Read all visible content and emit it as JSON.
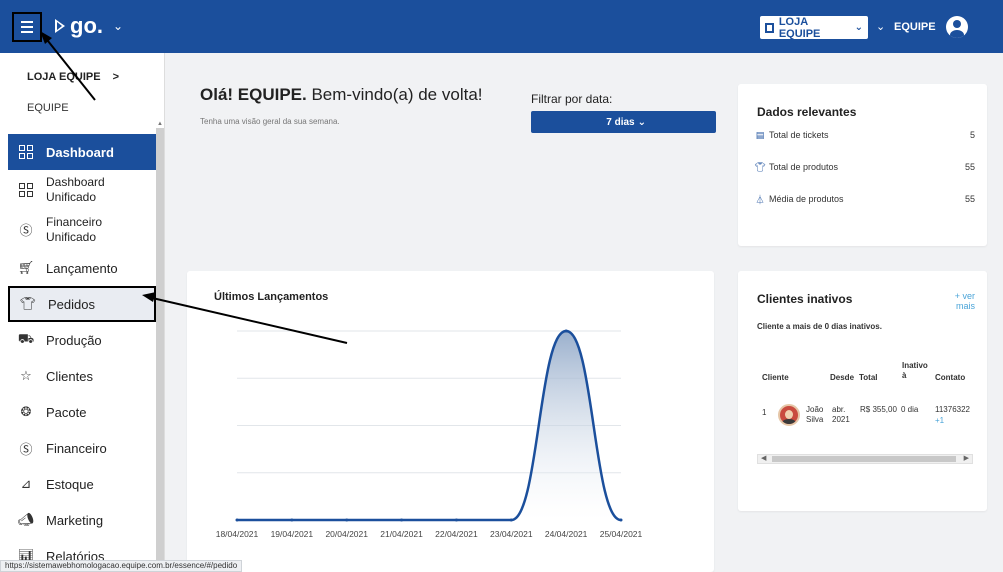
{
  "header": {
    "brand": "go.",
    "store_label": "LOJA EQUIPE",
    "user_label": "EQUIPE"
  },
  "sidebar": {
    "store_title": "LOJA EQUIPE",
    "store_chevron": ">",
    "store_subtitle": "EQUIPE",
    "items": [
      {
        "label": "Dashboard",
        "icon": "dashboard-icon"
      },
      {
        "label": "Dashboard\nUnificado",
        "icon": "dashboard-icon"
      },
      {
        "label": "Financeiro\nUnificado",
        "icon": "dollar-icon"
      },
      {
        "label": "Lançamento",
        "icon": "cart-icon"
      },
      {
        "label": "Pedidos",
        "icon": "shirt-icon"
      },
      {
        "label": "Produção",
        "icon": "truck-icon"
      },
      {
        "label": "Clientes",
        "icon": "star-icon"
      },
      {
        "label": "Pacote",
        "icon": "package-icon"
      },
      {
        "label": "Financeiro",
        "icon": "dollar-icon"
      },
      {
        "label": "Estoque",
        "icon": "stock-icon"
      },
      {
        "label": "Marketing",
        "icon": "megaphone-icon"
      },
      {
        "label": "Relatórios",
        "icon": "report-icon"
      }
    ]
  },
  "welcome": {
    "greeting_bold": "Olá! EQUIPE.",
    "greeting_rest": " Bem-vindo(a) de volta!",
    "subtitle": "Tenha uma visão geral da sua semana."
  },
  "filter": {
    "label": "Filtrar por data:",
    "value": "7 dias"
  },
  "relevant": {
    "title": "Dados relevantes",
    "rows": [
      {
        "label": "Total de tickets",
        "value": "5"
      },
      {
        "label": "Total de produtos",
        "value": "55"
      },
      {
        "label": "Média de produtos",
        "value": "55"
      }
    ]
  },
  "inactive": {
    "title": "Clientes inativos",
    "see_more": "+ ver mais",
    "subtitle": "Cliente a mais de 0 dias inativos.",
    "columns": [
      "Cliente",
      "Desde",
      "Total",
      "Inativo à",
      "Contato"
    ],
    "rows": [
      {
        "index": "1",
        "name": "João Silva",
        "since": "abr. 2021",
        "total": "R$ 355,00",
        "inactive": "0 dia",
        "contact": "11376322",
        "contact_more": "+1"
      }
    ]
  },
  "status_url": "https://sistemawebhomologacao.equipe.com.br/essence/#/pedido",
  "colors": {
    "primary": "#1b4f9c",
    "link": "#4aa4d8"
  },
  "chart_data": {
    "type": "area",
    "title": "Últimos Lançamentos",
    "x": [
      "18/04/2021",
      "19/04/2021",
      "20/04/2021",
      "21/04/2021",
      "22/04/2021",
      "23/04/2021",
      "24/04/2021",
      "25/04/2021"
    ],
    "series": [
      {
        "values": [
          0,
          0,
          0,
          0,
          0,
          0,
          4,
          0
        ]
      }
    ],
    "ylim": [
      0,
      4
    ],
    "grid": true
  }
}
